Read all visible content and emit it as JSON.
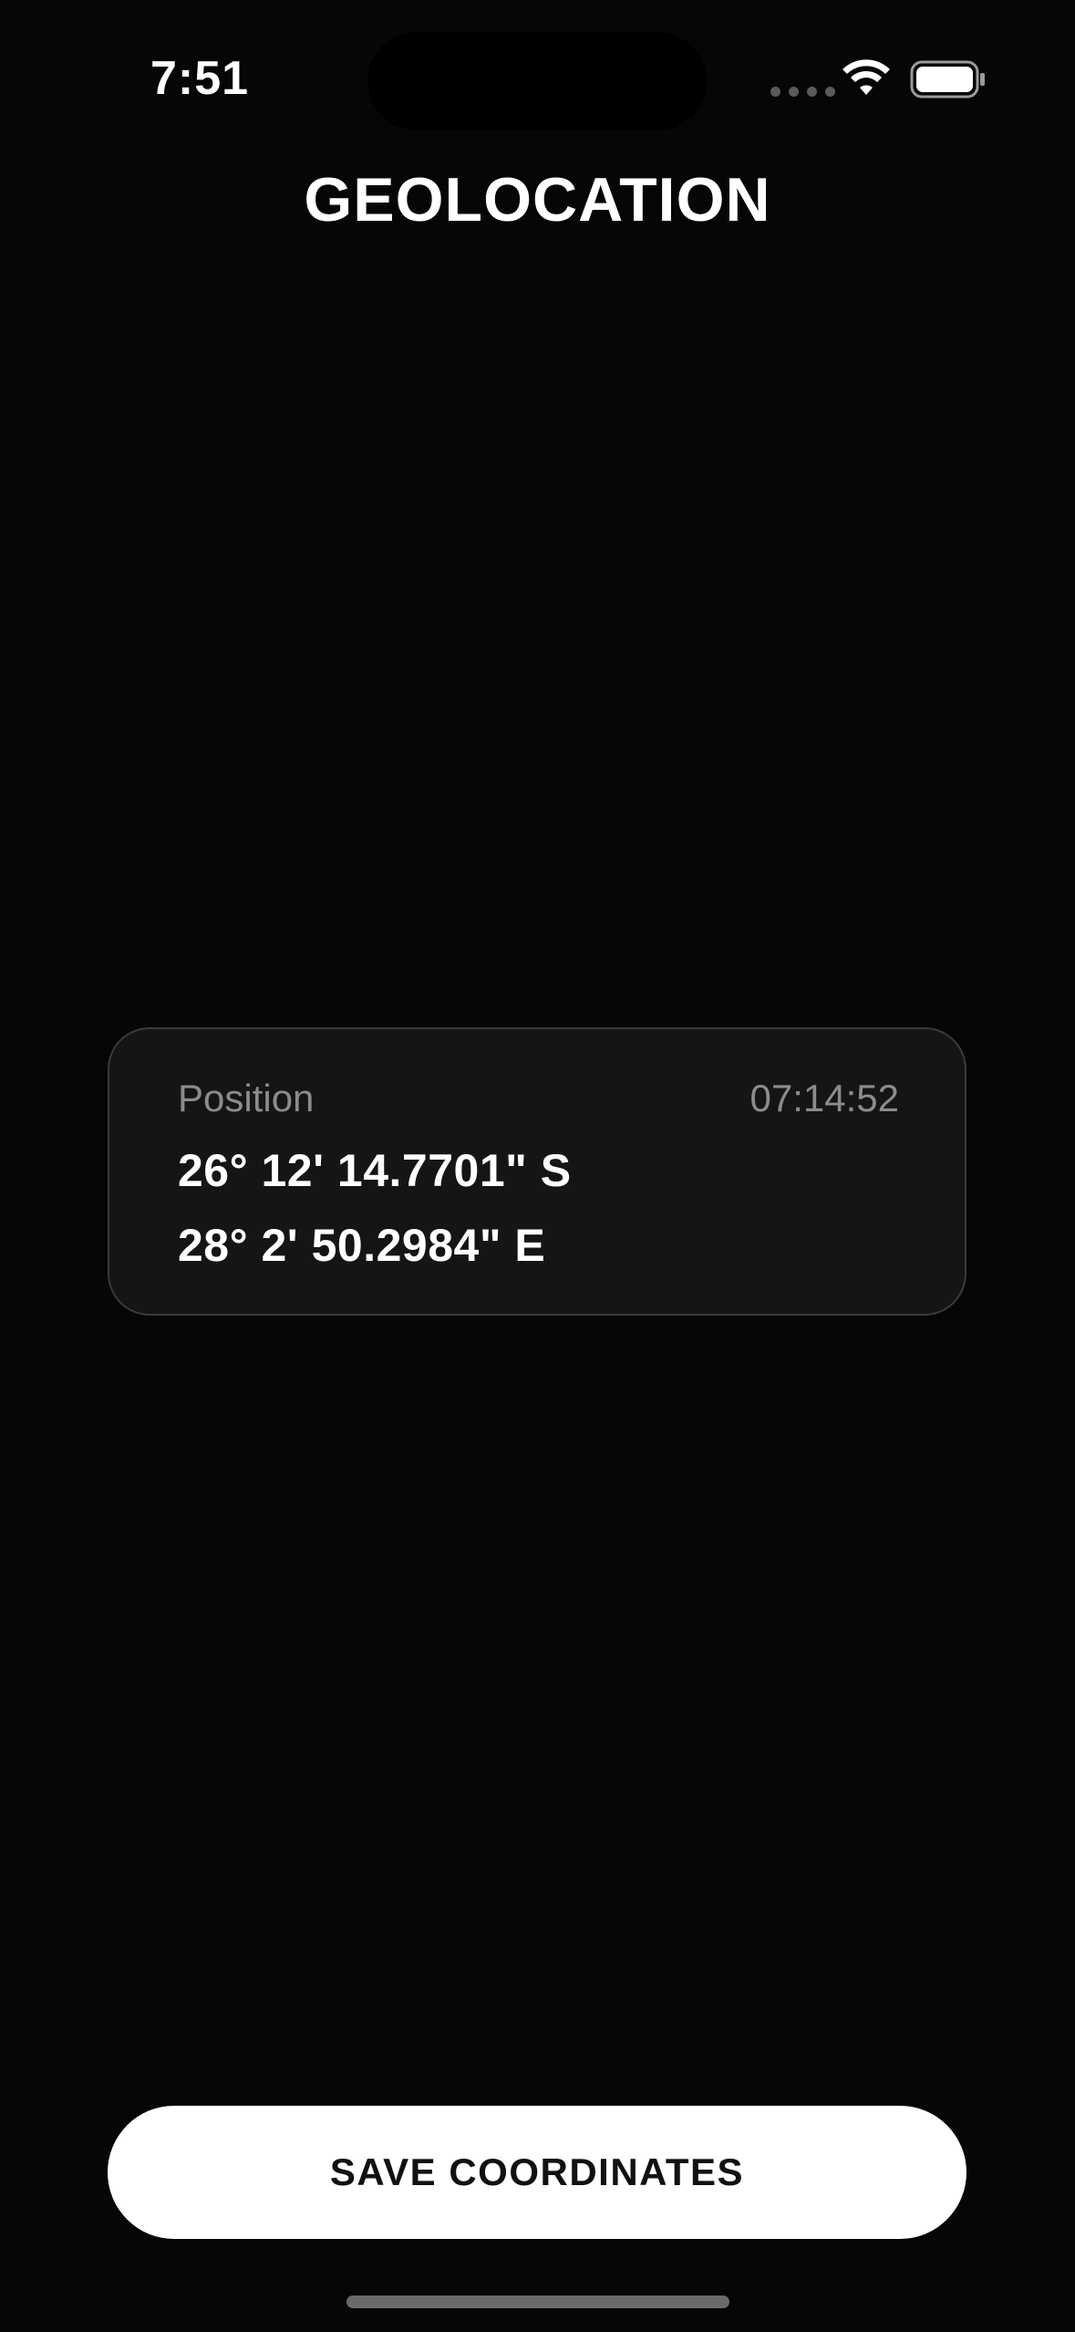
{
  "status_bar": {
    "time": "7:51",
    "icons": [
      "cellular-dots-icon",
      "wifi-icon",
      "battery-icon"
    ]
  },
  "page": {
    "title": "GEOLOCATION"
  },
  "position_card": {
    "label": "Position",
    "timestamp": "07:14:52",
    "latitude": "26° 12' 14.7701\" S",
    "longitude": "28° 2' 50.2984\" E"
  },
  "actions": {
    "save_label": "SAVE COORDINATES"
  },
  "colors": {
    "background": "#060606",
    "card_background": "#151515",
    "card_border": "#3a3a3a",
    "secondary_text": "#8c8c8c",
    "button_background": "#ffffff",
    "button_text": "#111111"
  }
}
